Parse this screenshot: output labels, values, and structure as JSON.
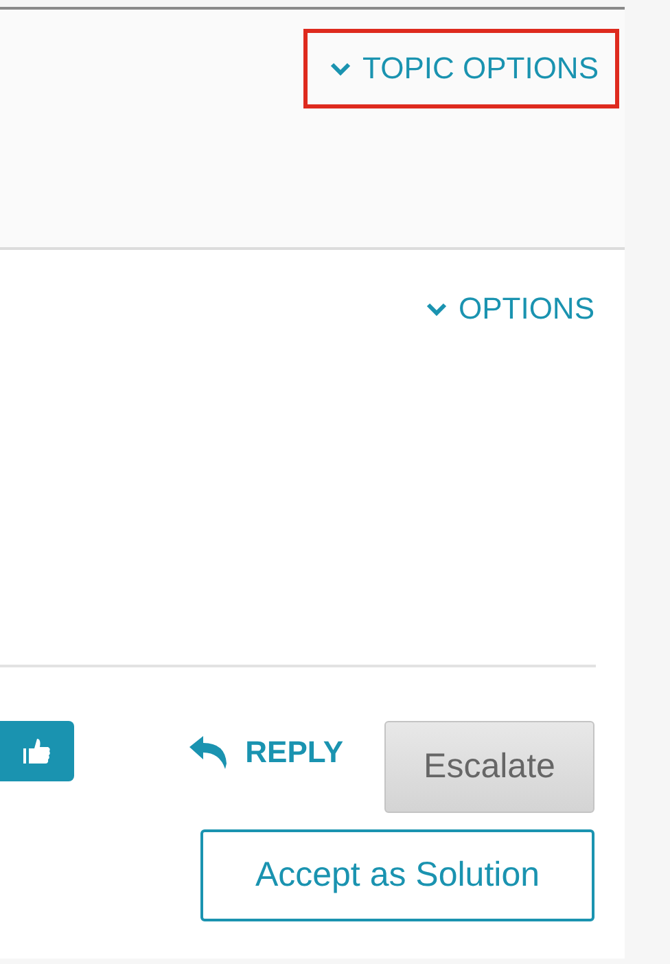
{
  "topic_header": {
    "options_link": {
      "label": "TOPIC OPTIONS",
      "highlighted": true
    }
  },
  "post": {
    "options_link": {
      "label": "OPTIONS"
    },
    "reply_link": {
      "label": "REPLY"
    },
    "buttons": [
      {
        "label": "Escalate",
        "kind": "secondary"
      },
      {
        "label": "Accept as Solution",
        "kind": "outline"
      }
    ]
  }
}
